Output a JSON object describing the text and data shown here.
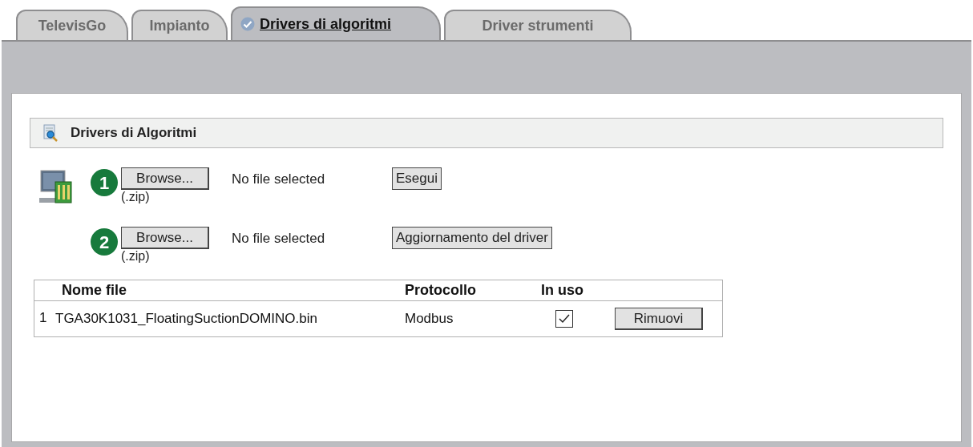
{
  "tabs": [
    {
      "label": "TelevisGo",
      "selected": false
    },
    {
      "label": "Impianto",
      "selected": false
    },
    {
      "label": "Drivers di algoritmi",
      "selected": true
    },
    {
      "label": "Driver strumenti",
      "selected": false
    }
  ],
  "section": {
    "title": "Drivers di Algoritmi"
  },
  "uploads": [
    {
      "step": "1",
      "browse": "Browse...",
      "status": "No file selected",
      "hint": "(.zip)",
      "action": "Esegui"
    },
    {
      "step": "2",
      "browse": "Browse...",
      "status": "No file selected",
      "hint": "(.zip)",
      "action": "Aggiornamento del driver"
    }
  ],
  "table": {
    "columns": [
      "Nome file",
      "Protocollo",
      "In uso"
    ],
    "rows": [
      {
        "index": "1",
        "file": "TGA30K1031_FloatingSuctionDOMINO.bin",
        "protocol": "Modbus",
        "in_use": true,
        "action": "Rimuovi"
      }
    ]
  }
}
